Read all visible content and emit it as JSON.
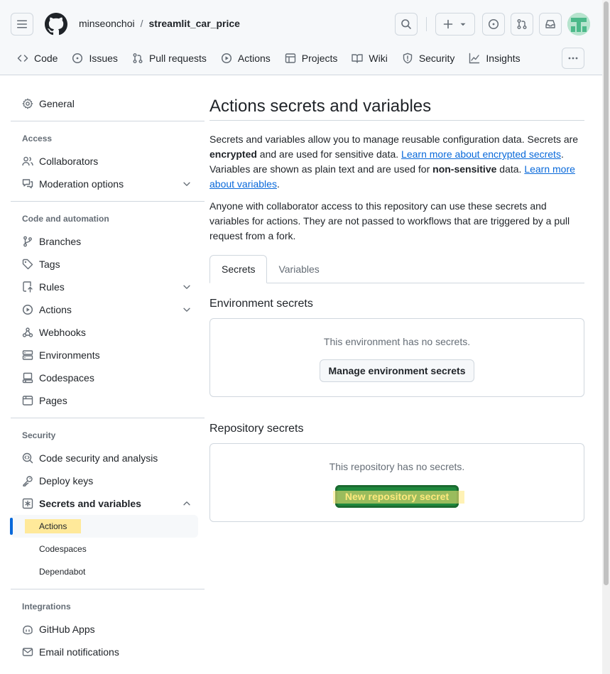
{
  "repo": {
    "owner": "minseonchoi",
    "separator": "/",
    "name": "streamlit_car_price"
  },
  "nav": [
    {
      "label": "Code",
      "icon": "code-icon"
    },
    {
      "label": "Issues",
      "icon": "issue-icon"
    },
    {
      "label": "Pull requests",
      "icon": "pull-request-icon"
    },
    {
      "label": "Actions",
      "icon": "play-icon"
    },
    {
      "label": "Projects",
      "icon": "table-icon"
    },
    {
      "label": "Wiki",
      "icon": "book-icon"
    },
    {
      "label": "Security",
      "icon": "shield-icon"
    },
    {
      "label": "Insights",
      "icon": "graph-icon"
    }
  ],
  "sidebar": {
    "general": "General",
    "access_heading": "Access",
    "access": [
      {
        "label": "Collaborators"
      },
      {
        "label": "Moderation options"
      }
    ],
    "code_heading": "Code and automation",
    "code": [
      {
        "label": "Branches"
      },
      {
        "label": "Tags"
      },
      {
        "label": "Rules"
      },
      {
        "label": "Actions"
      },
      {
        "label": "Webhooks"
      },
      {
        "label": "Environments"
      },
      {
        "label": "Codespaces"
      },
      {
        "label": "Pages"
      }
    ],
    "security_heading": "Security",
    "security": [
      {
        "label": "Code security and analysis"
      },
      {
        "label": "Deploy keys"
      },
      {
        "label": "Secrets and variables"
      }
    ],
    "secrets_sub": [
      {
        "label": "Actions"
      },
      {
        "label": "Codespaces"
      },
      {
        "label": "Dependabot"
      }
    ],
    "integrations_heading": "Integrations",
    "integrations": [
      {
        "label": "GitHub Apps"
      },
      {
        "label": "Email notifications"
      }
    ]
  },
  "main": {
    "title": "Actions secrets and variables",
    "para1": {
      "t1": "Secrets and variables allow you to manage reusable configuration data. Secrets are ",
      "b1": "encrypted",
      "t2": " and are used for sensitive data. ",
      "link1": "Learn more about encrypted secrets",
      "t3": ". Variables are shown as plain text and are used for ",
      "b2": "non-sensitive",
      "t4": " data. ",
      "link2": "Learn more about variables",
      "t5": "."
    },
    "para2": "Anyone with collaborator access to this repository can use these secrets and variables for actions. They are not passed to workflows that are triggered by a pull request from a fork.",
    "tabs": [
      "Secrets",
      "Variables"
    ],
    "env": {
      "heading": "Environment secrets",
      "empty": "This environment has no secrets.",
      "button": "Manage environment secrets"
    },
    "repo": {
      "heading": "Repository secrets",
      "empty": "This repository has no secrets.",
      "button": "New repository secret"
    }
  },
  "colors": {
    "accent": "#0969da",
    "green": "#1f883d",
    "highlight": "#ffe99a"
  }
}
